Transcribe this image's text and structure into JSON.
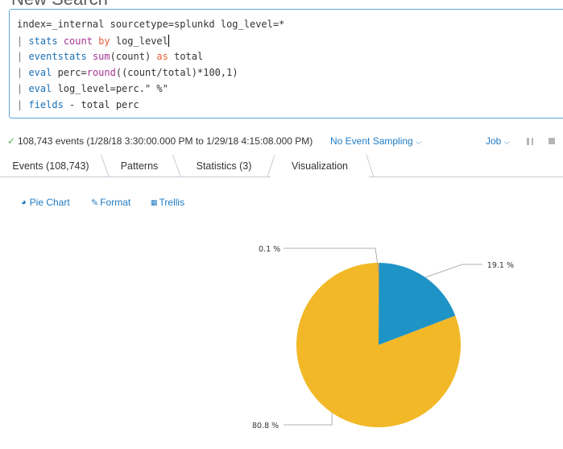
{
  "page": {
    "title": "New Search"
  },
  "search": {
    "lines": [
      [
        {
          "t": "index=_internal sourcetype=splunkd log_level=*",
          "c": ""
        }
      ],
      [
        {
          "t": "| ",
          "c": "pipe"
        },
        {
          "t": "stats",
          "c": "cmd"
        },
        {
          "t": " ",
          "c": ""
        },
        {
          "t": "count",
          "c": "fn"
        },
        {
          "t": " ",
          "c": ""
        },
        {
          "t": "by",
          "c": "kw"
        },
        {
          "t": " log_level",
          "c": ""
        }
      ],
      [
        {
          "t": "| ",
          "c": "pipe"
        },
        {
          "t": "eventstats",
          "c": "cmd"
        },
        {
          "t": " ",
          "c": ""
        },
        {
          "t": "sum",
          "c": "fn"
        },
        {
          "t": "(count) ",
          "c": ""
        },
        {
          "t": "as",
          "c": "kw"
        },
        {
          "t": " total",
          "c": ""
        }
      ],
      [
        {
          "t": "| ",
          "c": "pipe"
        },
        {
          "t": "eval",
          "c": "cmd"
        },
        {
          "t": " perc=",
          "c": ""
        },
        {
          "t": "round",
          "c": "fn"
        },
        {
          "t": "((count/total)*100,1)",
          "c": ""
        }
      ],
      [
        {
          "t": "| ",
          "c": "pipe"
        },
        {
          "t": "eval",
          "c": "cmd"
        },
        {
          "t": " log_level=perc.\" %\"",
          "c": ""
        }
      ],
      [
        {
          "t": "| ",
          "c": "pipe"
        },
        {
          "t": "fields",
          "c": "cmd"
        },
        {
          "t": " - total perc",
          "c": ""
        }
      ]
    ]
  },
  "status": {
    "check_icon": "checkmark-icon",
    "summary": "108,743 events (1/28/18 3:30:00.000 PM to 1/29/18 4:15:08.000 PM)",
    "sampling_label": "No Event Sampling",
    "job_label": "Job",
    "chevron": "⌄"
  },
  "tabs": [
    {
      "label": "Events (108,743)",
      "active": false
    },
    {
      "label": "Patterns",
      "active": false
    },
    {
      "label": "Statistics (3)",
      "active": false
    },
    {
      "label": "Visualization",
      "active": true
    }
  ],
  "viz_toolbar": {
    "pie_chart": "Pie Chart",
    "format": "Format",
    "trellis": "Trellis"
  },
  "chart_data": {
    "type": "pie",
    "slices": [
      {
        "label": "0.1 %",
        "value": 0.1,
        "color": "#ee8c2e"
      },
      {
        "label": "19.1 %",
        "value": 19.1,
        "color": "#1e93c6"
      },
      {
        "label": "80.8 %",
        "value": 80.8,
        "color": "#f2b827"
      }
    ]
  },
  "colors": {
    "link": "#1e7bc4",
    "focus_border": "#5fa5d9",
    "success": "#4cae4c"
  }
}
